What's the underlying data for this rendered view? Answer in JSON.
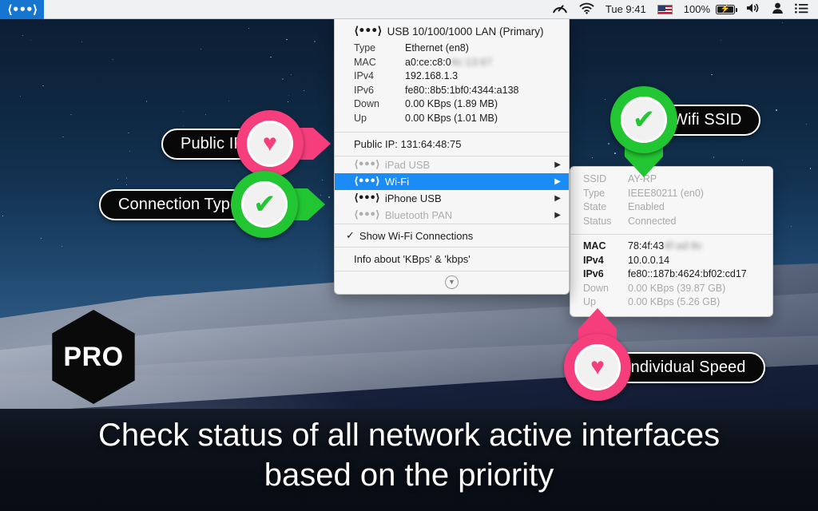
{
  "menubar": {
    "app_icon": "network-arrows-icon",
    "items": [
      {
        "name": "speedometer-icon",
        "label": "",
        "icon": "speedometer-icon"
      },
      {
        "name": "wifi-icon",
        "label": "",
        "icon": "wifi-icon"
      },
      {
        "name": "clock",
        "label": "Tue 9:41",
        "icon": ""
      },
      {
        "name": "input-flag",
        "label": "",
        "icon": "us-flag-icon"
      },
      {
        "name": "battery-percent",
        "label": "100%",
        "icon": ""
      },
      {
        "name": "battery",
        "label": "",
        "icon": "battery-charging-icon"
      },
      {
        "name": "volume-icon",
        "label": "",
        "icon": "speaker-icon"
      },
      {
        "name": "user-icon",
        "label": "",
        "icon": "user-icon"
      },
      {
        "name": "control-center",
        "label": "",
        "icon": "list-icon"
      }
    ],
    "clock": "Tue 9:41",
    "battery_percent": "100%"
  },
  "dropdown": {
    "header": {
      "icon": "network-arrows-icon",
      "title": "USB 10/100/1000 LAN (Primary)"
    },
    "details": [
      {
        "key": "Type",
        "value": "Ethernet (en8)",
        "blurred": false
      },
      {
        "key": "MAC",
        "value": "a0:ce:c8:0",
        "blurred": true,
        "blurred_value": "4c:13:67"
      },
      {
        "key": "IPv4",
        "value": "192.168.1.3",
        "blurred": false
      },
      {
        "key": "IPv6",
        "value": "fe80::8b5:1bf0:4344:a138",
        "blurred": false
      },
      {
        "key": "Down",
        "value": "0.00 KBps (1.89 MB)",
        "blurred": false
      },
      {
        "key": "Up",
        "value": "0.00 KBps (1.01 MB)",
        "blurred": false
      }
    ],
    "public_ip": "Public IP: 131:64:48:75",
    "interfaces": [
      {
        "label": "iPad USB",
        "state": "dim",
        "icon": "network-arrows-icon",
        "submenu_arrow": "▶"
      },
      {
        "label": "Wi-Fi",
        "state": "selected",
        "icon": "network-arrows-icon",
        "submenu_arrow": "▶"
      },
      {
        "label": "iPhone USB",
        "state": "normal",
        "icon": "network-arrows-icon",
        "submenu_arrow": "▶"
      },
      {
        "label": "Bluetooth PAN",
        "state": "dim",
        "icon": "network-arrows-icon",
        "submenu_arrow": "▶"
      }
    ],
    "show_wifi_label": "Show Wi-Fi Connections",
    "show_wifi_checked": "✓",
    "info_label": "Info about 'KBps' & 'kbps'",
    "more_icon": "chevron-down-icon"
  },
  "submenu": {
    "top_rows": [
      {
        "key": "SSID",
        "value": "AY-RP"
      },
      {
        "key": "Type",
        "value": "IEEE80211 (en0)"
      },
      {
        "key": "State",
        "value": "Enabled"
      },
      {
        "key": "Status",
        "value": "Connected"
      }
    ],
    "bottom_rows": [
      {
        "key": "MAC",
        "value": "78:4f:43",
        "blurred": true,
        "blurred_value": "4f:ad:8c",
        "muted": false
      },
      {
        "key": "IPv4",
        "value": "10.0.0.14",
        "blurred": false,
        "muted": false
      },
      {
        "key": "IPv6",
        "value": "fe80::187b:4624:bf02:cd17",
        "blurred": false,
        "muted": false
      },
      {
        "key": "Down",
        "value": "0.00 KBps (39.87 GB)",
        "blurred": false,
        "muted": true
      },
      {
        "key": "Up",
        "value": "0.00 KBps (5.26 GB)",
        "blurred": false,
        "muted": true
      }
    ]
  },
  "callouts": [
    {
      "id": "public-ip",
      "label": "Public IP",
      "color": "#f73e7c",
      "glyph": "♥",
      "icon": "heart-icon",
      "direction": "right"
    },
    {
      "id": "connection-type",
      "label": "Connection Type",
      "color": "#22c532",
      "glyph": "✔",
      "icon": "checkmark-icon",
      "direction": "right"
    },
    {
      "id": "wifi-ssid",
      "label": "Wifi SSID",
      "color": "#22c532",
      "glyph": "✔",
      "icon": "checkmark-icon",
      "direction": "down"
    },
    {
      "id": "individual-speed",
      "label": "Individual Speed",
      "color": "#f73e7c",
      "glyph": "♥",
      "icon": "heart-icon",
      "direction": "up"
    }
  ],
  "pro_badge": {
    "label": "PRO"
  },
  "caption": {
    "line1": "Check status of all network active interfaces",
    "line2": "based on the priority"
  },
  "colors": {
    "accent_blue": "#1b8bf5",
    "menubar_active": "#1675d1",
    "pink": "#f73e7c",
    "green": "#22c532",
    "panel_bg": "#f6f6f6"
  }
}
